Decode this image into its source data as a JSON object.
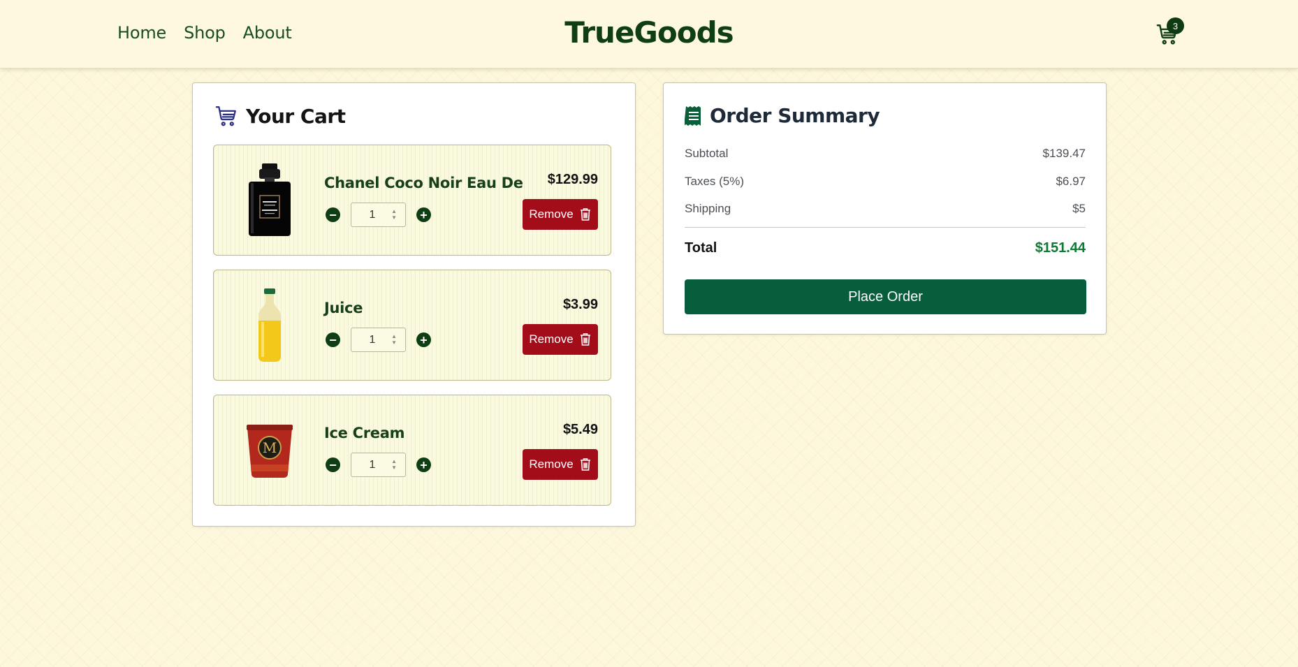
{
  "header": {
    "nav": [
      "Home",
      "Shop",
      "About"
    ],
    "logo": "TrueGoods",
    "cart_count": "3"
  },
  "cart": {
    "title": "Your Cart",
    "items": [
      {
        "name": "Chanel Coco Noir Eau De",
        "qty": "1",
        "price": "$129.99",
        "remove_label": "Remove",
        "image": "perfume-bottle"
      },
      {
        "name": "Juice",
        "qty": "1",
        "price": "$3.99",
        "remove_label": "Remove",
        "image": "juice-bottle"
      },
      {
        "name": "Ice Cream",
        "qty": "1",
        "price": "$5.49",
        "remove_label": "Remove",
        "image": "ice-cream-tub"
      }
    ]
  },
  "summary": {
    "title": "Order Summary",
    "subtotal_label": "Subtotal",
    "subtotal": "$139.47",
    "taxes_label": "Taxes (5%)",
    "taxes": "$6.97",
    "shipping_label": "Shipping",
    "shipping": "$5",
    "total_label": "Total",
    "total": "$151.44",
    "place_order": "Place Order"
  },
  "colors": {
    "brand_green": "#0f3d14",
    "remove_red": "#a30d1a",
    "place_order_green": "#075e3c",
    "total_green": "#0c7a33",
    "page_background": "#fdf7dc"
  }
}
